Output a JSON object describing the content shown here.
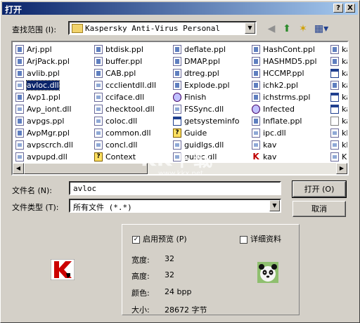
{
  "window": {
    "title": "打开"
  },
  "titlebar_buttons": {
    "help": "?",
    "close": "X"
  },
  "look_in": {
    "label": "查找范围 (I):",
    "value": "Kaspersky Anti-Virus Personal"
  },
  "file_columns": [
    [
      {
        "name": "Arj.ppl",
        "icon": "ppl-icon",
        "type": "ppl"
      },
      {
        "name": "ArjPack.ppl",
        "icon": "ppl-icon",
        "type": "ppl"
      },
      {
        "name": "avlib.ppl",
        "icon": "ppl-icon",
        "type": "ppl"
      },
      {
        "name": "avloc.dll",
        "icon": "dll-icon",
        "type": "dll",
        "selected": true
      },
      {
        "name": "Avp1.ppl",
        "icon": "ppl-icon",
        "type": "ppl"
      },
      {
        "name": "Avp_iont.dll",
        "icon": "dll-icon",
        "type": "dll"
      },
      {
        "name": "avpgs.ppl",
        "icon": "ppl-icon",
        "type": "ppl"
      },
      {
        "name": "AvpMgr.ppl",
        "icon": "ppl-icon",
        "type": "ppl"
      },
      {
        "name": "avpscrch.dll",
        "icon": "dll-icon",
        "type": "dll"
      },
      {
        "name": "avpupd.dll",
        "icon": "dll-icon",
        "type": "dll"
      }
    ],
    [
      {
        "name": "btdisk.ppl",
        "icon": "ppl-icon",
        "type": "ppl"
      },
      {
        "name": "buffer.ppl",
        "icon": "ppl-icon",
        "type": "ppl"
      },
      {
        "name": "CAB.ppl",
        "icon": "ppl-icon",
        "type": "ppl"
      },
      {
        "name": "ccclientdll.dll",
        "icon": "dll-icon",
        "type": "dll"
      },
      {
        "name": "cciface.dll",
        "icon": "dll-icon",
        "type": "dll"
      },
      {
        "name": "checktool.dll",
        "icon": "dll-icon",
        "type": "dll"
      },
      {
        "name": "coloc.dll",
        "icon": "dll-icon",
        "type": "dll"
      },
      {
        "name": "common.dll",
        "icon": "dll-icon",
        "type": "dll"
      },
      {
        "name": "concl.dll",
        "icon": "dll-icon",
        "type": "dll"
      },
      {
        "name": "Context",
        "icon": "help-icon",
        "type": "help"
      }
    ],
    [
      {
        "name": "deflate.ppl",
        "icon": "ppl-icon",
        "type": "ppl"
      },
      {
        "name": "DMAP.ppl",
        "icon": "ppl-icon",
        "type": "ppl"
      },
      {
        "name": "dtreg.ppl",
        "icon": "ppl-icon",
        "type": "ppl"
      },
      {
        "name": "Explode.ppl",
        "icon": "ppl-icon",
        "type": "ppl"
      },
      {
        "name": "Finish",
        "icon": "cd-icon",
        "type": "cd"
      },
      {
        "name": "FSSync.dll",
        "icon": "dll-icon",
        "type": "dll"
      },
      {
        "name": "getsysteminfo",
        "icon": "exe-icon",
        "type": "exe"
      },
      {
        "name": "Guide",
        "icon": "help-icon",
        "type": "help"
      },
      {
        "name": "guidlgs.dll",
        "icon": "dll-icon",
        "type": "dll"
      },
      {
        "name": "guloc.dll",
        "icon": "dll-icon",
        "type": "dll"
      }
    ],
    [
      {
        "name": "HashCont.ppl",
        "icon": "ppl-icon",
        "type": "ppl"
      },
      {
        "name": "HASHMD5.ppl",
        "icon": "ppl-icon",
        "type": "ppl"
      },
      {
        "name": "HCCMP.ppl",
        "icon": "ppl-icon",
        "type": "ppl"
      },
      {
        "name": "ichk2.ppl",
        "icon": "ppl-icon",
        "type": "ppl"
      },
      {
        "name": "ichstrms.ppl",
        "icon": "ppl-icon",
        "type": "ppl"
      },
      {
        "name": "Infected",
        "icon": "cd-icon",
        "type": "cd"
      },
      {
        "name": "Inflate.ppl",
        "icon": "ppl-icon",
        "type": "ppl"
      },
      {
        "name": "ipc.dll",
        "icon": "dll-icon",
        "type": "dll"
      },
      {
        "name": "kav",
        "icon": "dll-icon",
        "type": "dll"
      },
      {
        "name": "kav",
        "icon": "kav-icon",
        "type": "kav"
      }
    ],
    [
      {
        "name": "ka",
        "icon": "ppl-icon",
        "type": "ppl"
      },
      {
        "name": "ka",
        "icon": "ppl-icon",
        "type": "ppl"
      },
      {
        "name": "ka",
        "icon": "exe-icon",
        "type": "exe"
      },
      {
        "name": "ka",
        "icon": "ppl-icon",
        "type": "ppl"
      },
      {
        "name": "ka",
        "icon": "exe-icon",
        "type": "exe"
      },
      {
        "name": "ka",
        "icon": "exe-icon",
        "type": "exe"
      },
      {
        "name": "ka",
        "icon": "text-icon",
        "type": "txt"
      },
      {
        "name": "klc",
        "icon": "dll-icon",
        "type": "dll"
      },
      {
        "name": "klc",
        "icon": "dll-icon",
        "type": "dll"
      },
      {
        "name": "KL",
        "icon": "dll-icon",
        "type": "dll"
      }
    ]
  ],
  "filename": {
    "label": "文件名 (N):",
    "value": "avloc"
  },
  "filetype": {
    "label": "文件类型 (T):",
    "value": "所有文件 (*.*)"
  },
  "buttons": {
    "open": "打开 (O)",
    "cancel": "取消"
  },
  "preview": {
    "enable_label": "启用预览 (P)",
    "enable_checked": true,
    "details_label": "详细资料",
    "details_checked": false,
    "width_label": "宽度:",
    "width_value": "32",
    "height_label": "高度:",
    "height_value": "32",
    "color_label": "颜色:",
    "color_value": "24 bpp",
    "size_label": "大小:",
    "size_value": "28672 字节"
  },
  "watermark": {
    "main": "KK下载",
    "sub": "www.kkx.net"
  }
}
